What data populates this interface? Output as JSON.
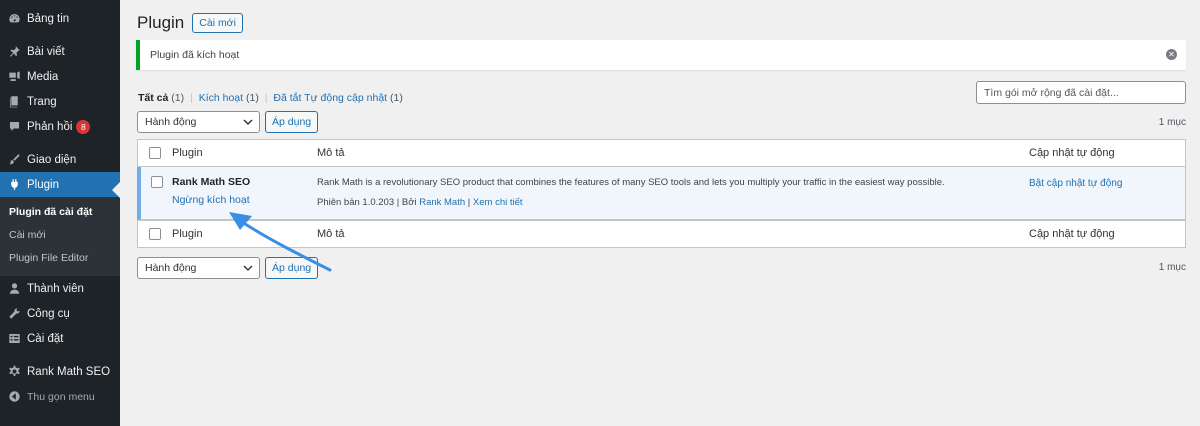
{
  "sidebar": {
    "items": [
      {
        "label": "Bảng tin",
        "icon": "dashboard-icon"
      },
      {
        "label": "Bài viết",
        "icon": "pin-icon"
      },
      {
        "label": "Media",
        "icon": "media-icon"
      },
      {
        "label": "Trang",
        "icon": "pages-icon"
      },
      {
        "label": "Phản hồi",
        "icon": "comments-icon",
        "badge": "8"
      },
      {
        "label": "Giao diện",
        "icon": "brush-icon"
      },
      {
        "label": "Plugin",
        "icon": "plugin-icon",
        "active": true
      },
      {
        "label": "Thành viên",
        "icon": "users-icon"
      },
      {
        "label": "Công cụ",
        "icon": "wrench-icon"
      },
      {
        "label": "Cài đặt",
        "icon": "settings-icon"
      },
      {
        "label": "Rank Math SEO",
        "icon": "gear-icon"
      },
      {
        "label": "Thu gọn menu",
        "icon": "collapse-icon"
      }
    ],
    "submenu": [
      {
        "label": "Plugin đã cài đặt",
        "current": true
      },
      {
        "label": "Cài mới"
      },
      {
        "label": "Plugin File Editor"
      }
    ]
  },
  "header": {
    "title": "Plugin",
    "add_new": "Cài mới"
  },
  "notice": {
    "text": "Plugin đã kích hoạt"
  },
  "filters": {
    "all_label": "Tất cả",
    "all_count": "(1)",
    "active_label": "Kích hoạt",
    "active_count": "(1)",
    "autoupdate_off_label": "Đã tắt Tự động cập nhật",
    "autoupdate_off_count": "(1)"
  },
  "search": {
    "placeholder": "Tìm gói mở rộng đã cài đặt..."
  },
  "bulk": {
    "action_label": "Hành động",
    "apply_label": "Áp dụng",
    "count": "1 mục"
  },
  "table": {
    "columns": [
      "Plugin",
      "Mô tả",
      "Cập nhật tự động"
    ],
    "rows": [
      {
        "name": "Rank Math SEO",
        "action": "Ngừng kích hoạt",
        "description": "Rank Math is a revolutionary SEO product that combines the features of many SEO tools and lets you multiply your traffic in the easiest way possible.",
        "version": "Phiên bản 1.0.203",
        "by_label": "Bởi",
        "author": "Rank Math",
        "details": "Xem chi tiết",
        "auto_update": "Bật cập nhật tự động"
      }
    ]
  },
  "colors": {
    "sidebar_bg": "#1d2327",
    "accent": "#2271b1",
    "notice_success": "#00a32a",
    "annotation_arrow": "#3a8ee6",
    "badge": "#d63638"
  }
}
